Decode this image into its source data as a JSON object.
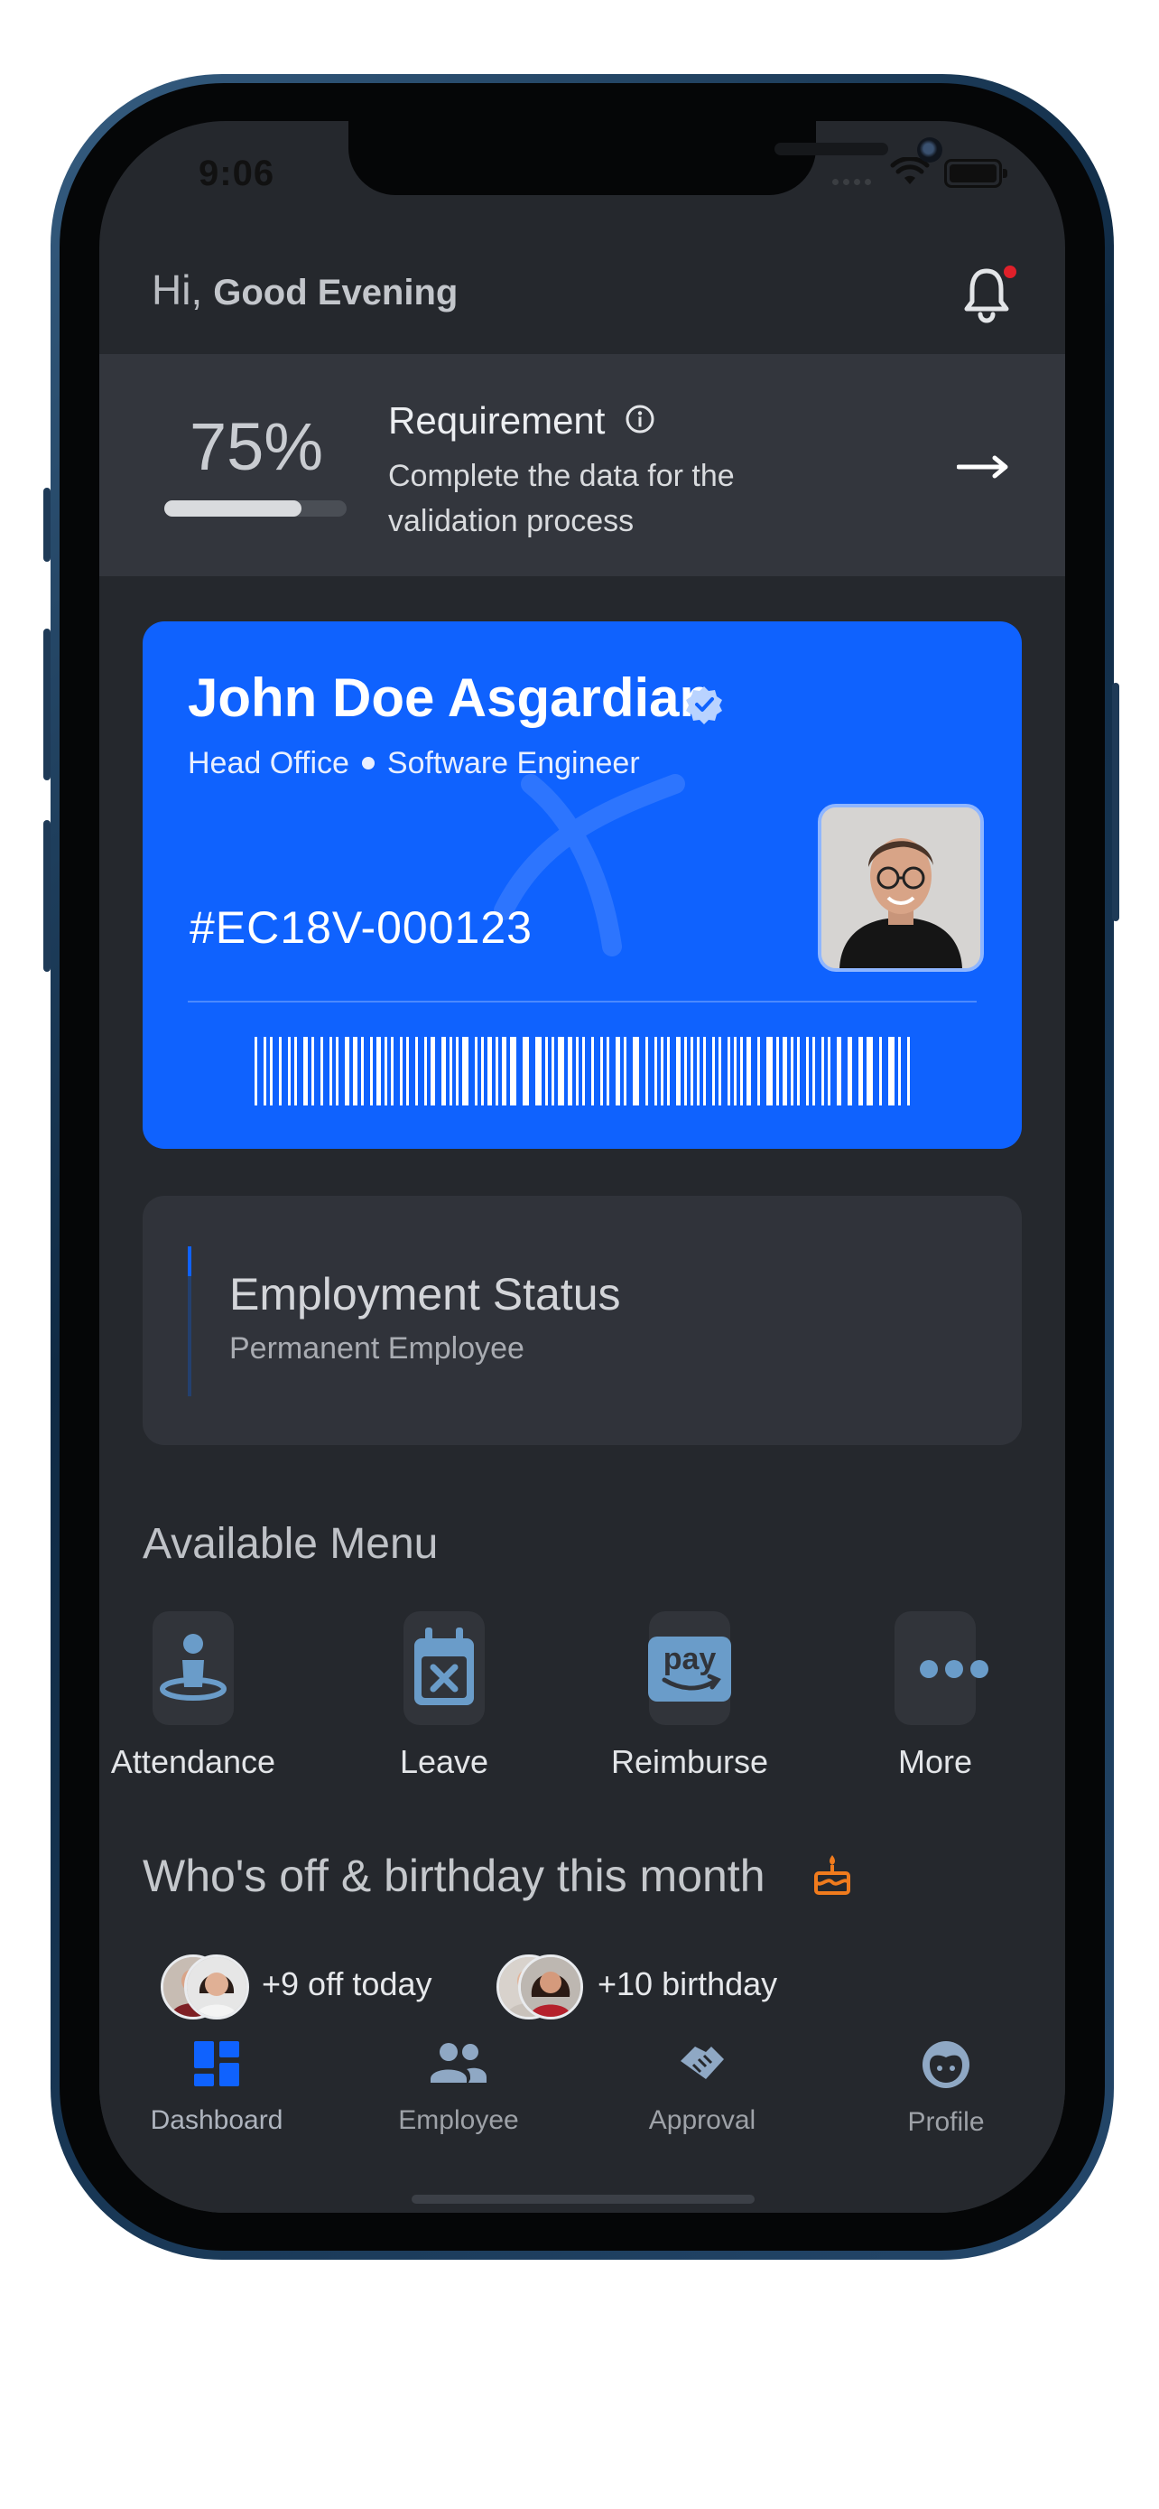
{
  "status_bar": {
    "time": "9:06"
  },
  "header": {
    "hi": "Hi,",
    "greeting": "Good Evening"
  },
  "requirement": {
    "percent_text": "75%",
    "progress": 0.75,
    "title": "Requirement",
    "description": "Complete the data for the validation process"
  },
  "id_card": {
    "name": "John Doe Asgardian",
    "office": "Head Office",
    "role": "Software Engineer",
    "employee_id": "#EC18V-000123",
    "card_color": "#0f62fe"
  },
  "employment": {
    "title": "Employment Status",
    "value": "Permanent Employee"
  },
  "menu": {
    "title": "Available Menu",
    "items": [
      {
        "label": "Attendance",
        "icon": "attendance-icon"
      },
      {
        "label": "Leave",
        "icon": "calendar-x-icon"
      },
      {
        "label": "Reimburse",
        "icon": "pay-icon"
      },
      {
        "label": "More",
        "icon": "more-dots-icon"
      }
    ]
  },
  "off_birthday": {
    "title": "Who's off & birthday this month",
    "off_label": "+9 off today",
    "birthday_label": "+10 birthday"
  },
  "tabbar": {
    "items": [
      {
        "label": "Dashboard",
        "icon": "dashboard-icon",
        "active": true
      },
      {
        "label": "Employee",
        "icon": "people-icon"
      },
      {
        "label": "Approval",
        "icon": "handshake-icon"
      },
      {
        "label": "Profile",
        "icon": "face-icon"
      }
    ]
  },
  "colors": {
    "accent": "#0f62fe",
    "background": "#25282d",
    "notification": "#e0202a",
    "cake": "#f07b1d"
  }
}
